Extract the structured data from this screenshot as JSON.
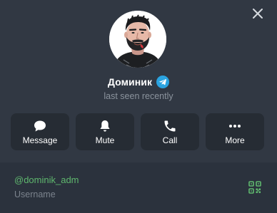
{
  "profile": {
    "name": "Доминик",
    "status": "last seen recently",
    "avatar_icon": "person-avatar-illustration",
    "badge_icon": "telegram-icon"
  },
  "actions": [
    {
      "label": "Message",
      "icon": "message-icon"
    },
    {
      "label": "Mute",
      "icon": "bell-icon"
    },
    {
      "label": "Call",
      "icon": "phone-icon"
    },
    {
      "label": "More",
      "icon": "more-dots-icon"
    }
  ],
  "info": {
    "username": "@dominik_adm",
    "username_caption": "Username",
    "qr_icon": "qr-code-icon"
  },
  "colors": {
    "header_bg": "#313843",
    "info_bg": "#2b323d",
    "button_bg": "#262c34",
    "accent_green": "#5fb86e",
    "badge_blue": "#2aa3e0",
    "muted_text": "#8b939d"
  }
}
